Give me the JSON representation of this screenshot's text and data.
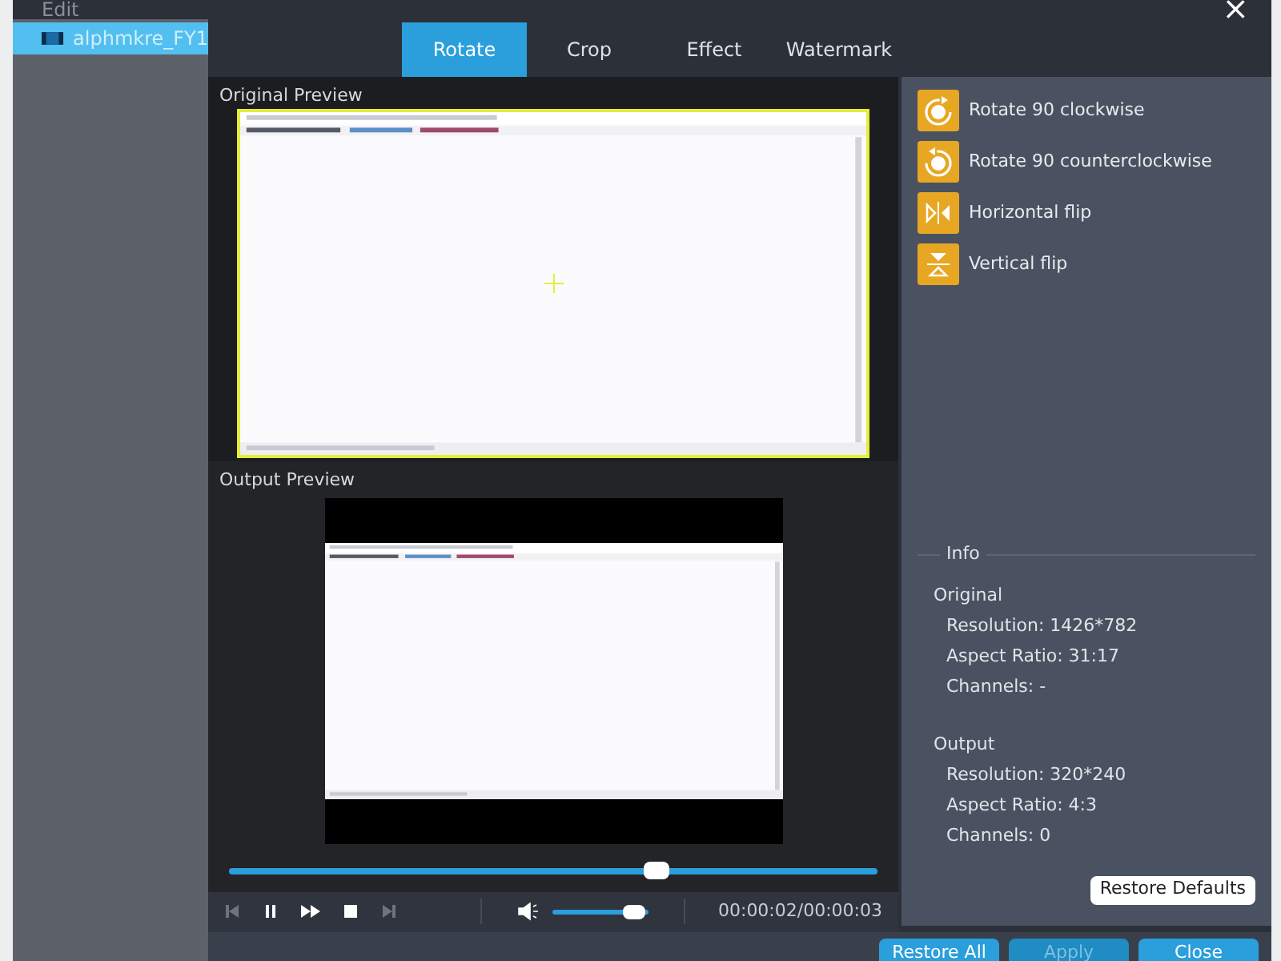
{
  "window": {
    "title": "Edit",
    "close": "×"
  },
  "sidebar": {
    "items": [
      {
        "label": "alphmkre_FY1",
        "selected": true
      }
    ]
  },
  "tabs": [
    {
      "label": "Rotate",
      "selected": true
    },
    {
      "label": "Crop",
      "selected": false
    },
    {
      "label": "Effect",
      "selected": false
    },
    {
      "label": "Watermark",
      "selected": false
    }
  ],
  "original_preview": {
    "title": "Original Preview",
    "kind": "picture"
  },
  "output_preview": {
    "title": "Output Preview",
    "kind": "picture"
  },
  "player": {
    "progress": {
      "level": 0.66
    },
    "volume": {
      "level": 0.85
    },
    "time": "00:00:02/00:00:03"
  },
  "rotate_options": [
    {
      "kind": "cw",
      "label": "Rotate 90 clockwise"
    },
    {
      "kind": "ccw",
      "label": "Rotate 90 counterclockwise"
    },
    {
      "kind": "hflip",
      "label": "Horizontal flip"
    },
    {
      "kind": "vflip",
      "label": "Vertical flip"
    }
  ],
  "info": {
    "title": "Info",
    "groups": [
      {
        "title": "Original",
        "lines": [
          "Resolution: 1426*782",
          "Aspect Ratio: 31:17",
          "Channels: -"
        ]
      },
      {
        "title": "Output",
        "lines": [
          "Resolution: 320*240",
          "Aspect Ratio: 4:3",
          "Channels: 0"
        ]
      }
    ]
  },
  "restore_defaults": "Restore Defaults",
  "buttons": [
    {
      "label": "Restore All",
      "disabled": false
    },
    {
      "label": "Apply",
      "disabled": true
    },
    {
      "label": "Close",
      "disabled": false
    }
  ]
}
